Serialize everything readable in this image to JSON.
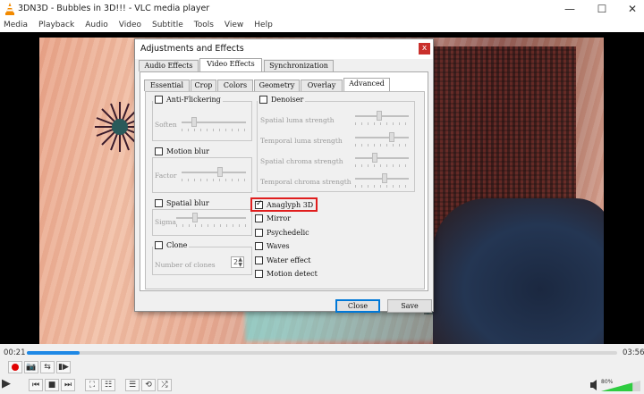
{
  "window": {
    "title": "3DN3D - Bubbles in 3D!!! - VLC media player",
    "minimize_glyph": "—",
    "maximize_glyph": "☐",
    "close_glyph": "✕"
  },
  "menu": [
    "Media",
    "Playback",
    "Audio",
    "Video",
    "Subtitle",
    "Tools",
    "View",
    "Help"
  ],
  "dialog": {
    "title": "Adjustments and Effects",
    "close_glyph": "x",
    "main_tabs": [
      {
        "label": "Audio Effects",
        "active": false
      },
      {
        "label": "Video Effects",
        "active": true
      },
      {
        "label": "Synchronization",
        "active": false
      }
    ],
    "sub_tabs": [
      {
        "label": "Essential",
        "active": false
      },
      {
        "label": "Crop",
        "active": false
      },
      {
        "label": "Colors",
        "active": false
      },
      {
        "label": "Geometry",
        "active": false
      },
      {
        "label": "Overlay",
        "active": false
      },
      {
        "label": "Advanced",
        "active": true
      }
    ],
    "groups": {
      "anti_flickering": {
        "label": "Anti-Flickering",
        "checked": false,
        "param": "Soften",
        "value": 0.17
      },
      "motion_blur": {
        "label": "Motion blur",
        "checked": false,
        "param": "Factor",
        "value": 0.6
      },
      "spatial_blur": {
        "label": "Spatial blur",
        "checked": false,
        "param": "Sigma",
        "value": 0.25
      },
      "clone": {
        "label": "Clone",
        "checked": false,
        "param": "Number of clones",
        "value": "2"
      },
      "denoiser": {
        "label": "Denoiser",
        "checked": false,
        "params": [
          {
            "label": "Spatial luma strength",
            "value": 0.45
          },
          {
            "label": "Temporal luma strength",
            "value": 0.7
          },
          {
            "label": "Spatial chroma strength",
            "value": 0.35
          },
          {
            "label": "Temporal chroma strength",
            "value": 0.55
          }
        ]
      }
    },
    "checkboxes": [
      {
        "label": "Anaglyph 3D",
        "checked": true
      },
      {
        "label": "Mirror",
        "checked": false
      },
      {
        "label": "Psychedelic",
        "checked": false
      },
      {
        "label": "Waves",
        "checked": false
      },
      {
        "label": "Water effect",
        "checked": false
      },
      {
        "label": "Motion detect",
        "checked": false
      }
    ],
    "buttons": {
      "close": "Close",
      "save": "Save"
    }
  },
  "player": {
    "elapsed": "00:21",
    "duration": "03:56",
    "progress": 0.09,
    "volume_label": "80%",
    "volume": 0.8
  }
}
